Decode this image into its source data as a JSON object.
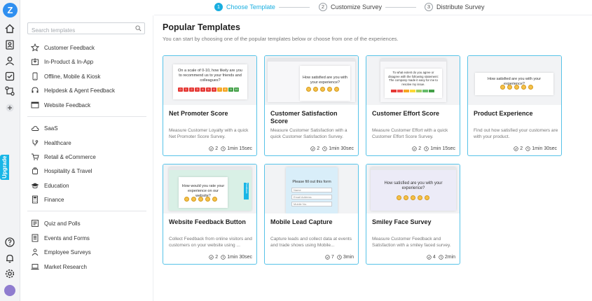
{
  "app": {
    "logo_letter": "Z",
    "upgrade_label": "Upgrade"
  },
  "steps": [
    {
      "num": "1",
      "label": "Choose Template"
    },
    {
      "num": "2",
      "label": "Customize Survey"
    },
    {
      "num": "3",
      "label": "Distribute Survey"
    }
  ],
  "search": {
    "placeholder": "Search templates"
  },
  "categories": [
    {
      "label": "Customer Feedback",
      "icon": "star-icon"
    },
    {
      "label": "In-Product & In-App",
      "icon": "download-box-icon"
    },
    {
      "label": "Offline, Mobile & Kiosk",
      "icon": "mobile-icon"
    },
    {
      "label": "Helpdesk & Agent Feedback",
      "icon": "headset-icon"
    },
    {
      "label": "Website Feedback",
      "icon": "browser-icon"
    },
    {
      "label": "SaaS",
      "icon": "cloud-icon"
    },
    {
      "label": "Healthcare",
      "icon": "stethoscope-icon"
    },
    {
      "label": "Retail & eCommerce",
      "icon": "cart-icon"
    },
    {
      "label": "Hospitality & Travel",
      "icon": "luggage-icon"
    },
    {
      "label": "Education",
      "icon": "graduation-cap-icon"
    },
    {
      "label": "Finance",
      "icon": "calculator-icon"
    },
    {
      "label": "Quiz and Polls",
      "icon": "quiz-icon"
    },
    {
      "label": "Events and Forms",
      "icon": "form-icon"
    },
    {
      "label": "Employee Surveys",
      "icon": "employee-icon"
    },
    {
      "label": "Market Research",
      "icon": "laptop-icon"
    }
  ],
  "main": {
    "title": "Popular Templates",
    "subtitle": "You can start by choosing one of the popular templates below or choose from one of the experiences."
  },
  "cards": [
    {
      "title": "Net Promoter Score",
      "desc": "Measure Customer Loyalty with a quick Net Promoter Score Survey.",
      "questions": "2",
      "time": "1min 15sec",
      "preview_text": "On a scale of 0-10, how likely are you to recommend us to your friends and colleagues?"
    },
    {
      "title": "Customer Satisfaction Score",
      "desc": "Measure Customer Satisfaction with a quick Customer Satisfaction Survey.",
      "questions": "2",
      "time": "1min 30sec",
      "preview_text": "How satisfied are you with your experience?"
    },
    {
      "title": "Customer Effort Score",
      "desc": "Measure Customer Effort with a quick Customer Effort Score Survey.",
      "questions": "2",
      "time": "1min 15sec",
      "preview_text": "To what extent do you agree or disagree with the following statement: The company made it easy for me to resolve my issue."
    },
    {
      "title": "Product Experience",
      "desc": "Find out how satisfied your customers are with your product.",
      "questions": "2",
      "time": "1min 30sec",
      "preview_text": "How satisfied are you with your experience?"
    },
    {
      "title": "Website Feedback Button",
      "desc": "Collect Feedback from online visitors and customers on your website using ...",
      "questions": "2",
      "time": "1min 30sec",
      "preview_text": "How would you rate your experience on our website?",
      "tab_label": "Feedback"
    },
    {
      "title": "Mobile Lead Capture",
      "desc": "Capture leads and collect data at events and trade shows using Mobile...",
      "questions": "7",
      "time": "3min",
      "preview_text": "Please fill out this form",
      "fields": [
        "Name",
        "Email Address",
        "Mobile No."
      ]
    },
    {
      "title": "Smiley Face Survey",
      "desc": "Measure Customer Feedback and Satisfaction with a smiley faced survey.",
      "questions": "4",
      "time": "2min",
      "preview_text": "How satisfied are you with your experience?"
    }
  ],
  "colors": {
    "accent": "#19aee0",
    "card_border": "#57c3e8",
    "brand": "#2f8ff0"
  }
}
